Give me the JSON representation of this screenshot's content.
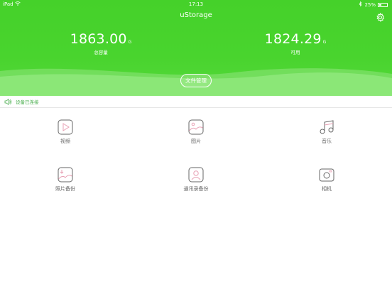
{
  "status_bar": {
    "device": "iPad",
    "time": "17:13",
    "battery": "25%",
    "battery_level": 0.25
  },
  "header": {
    "title": "uStorage",
    "settings_icon": "gear-icon"
  },
  "stats": {
    "total": {
      "value": "1863.00",
      "unit": "G",
      "label": "总容量"
    },
    "available": {
      "value": "1824.29",
      "unit": "G",
      "label": "可用"
    }
  },
  "file_manage_label": "文件管理",
  "device_status": {
    "text": "设备已连接",
    "icon": "speaker-icon",
    "color": "#4caf50"
  },
  "grid": [
    {
      "label": "视频",
      "icon": "play-icon"
    },
    {
      "label": "图片",
      "icon": "image-icon"
    },
    {
      "label": "音乐",
      "icon": "music-icon"
    },
    {
      "label": "照片备份",
      "icon": "photo-backup-icon"
    },
    {
      "label": "通讯录备份",
      "icon": "contacts-icon"
    },
    {
      "label": "相机",
      "icon": "camera-icon"
    }
  ],
  "colors": {
    "accent": "#45d12a",
    "icon_stroke": "#666666",
    "icon_accent": "#e8a0b4"
  }
}
